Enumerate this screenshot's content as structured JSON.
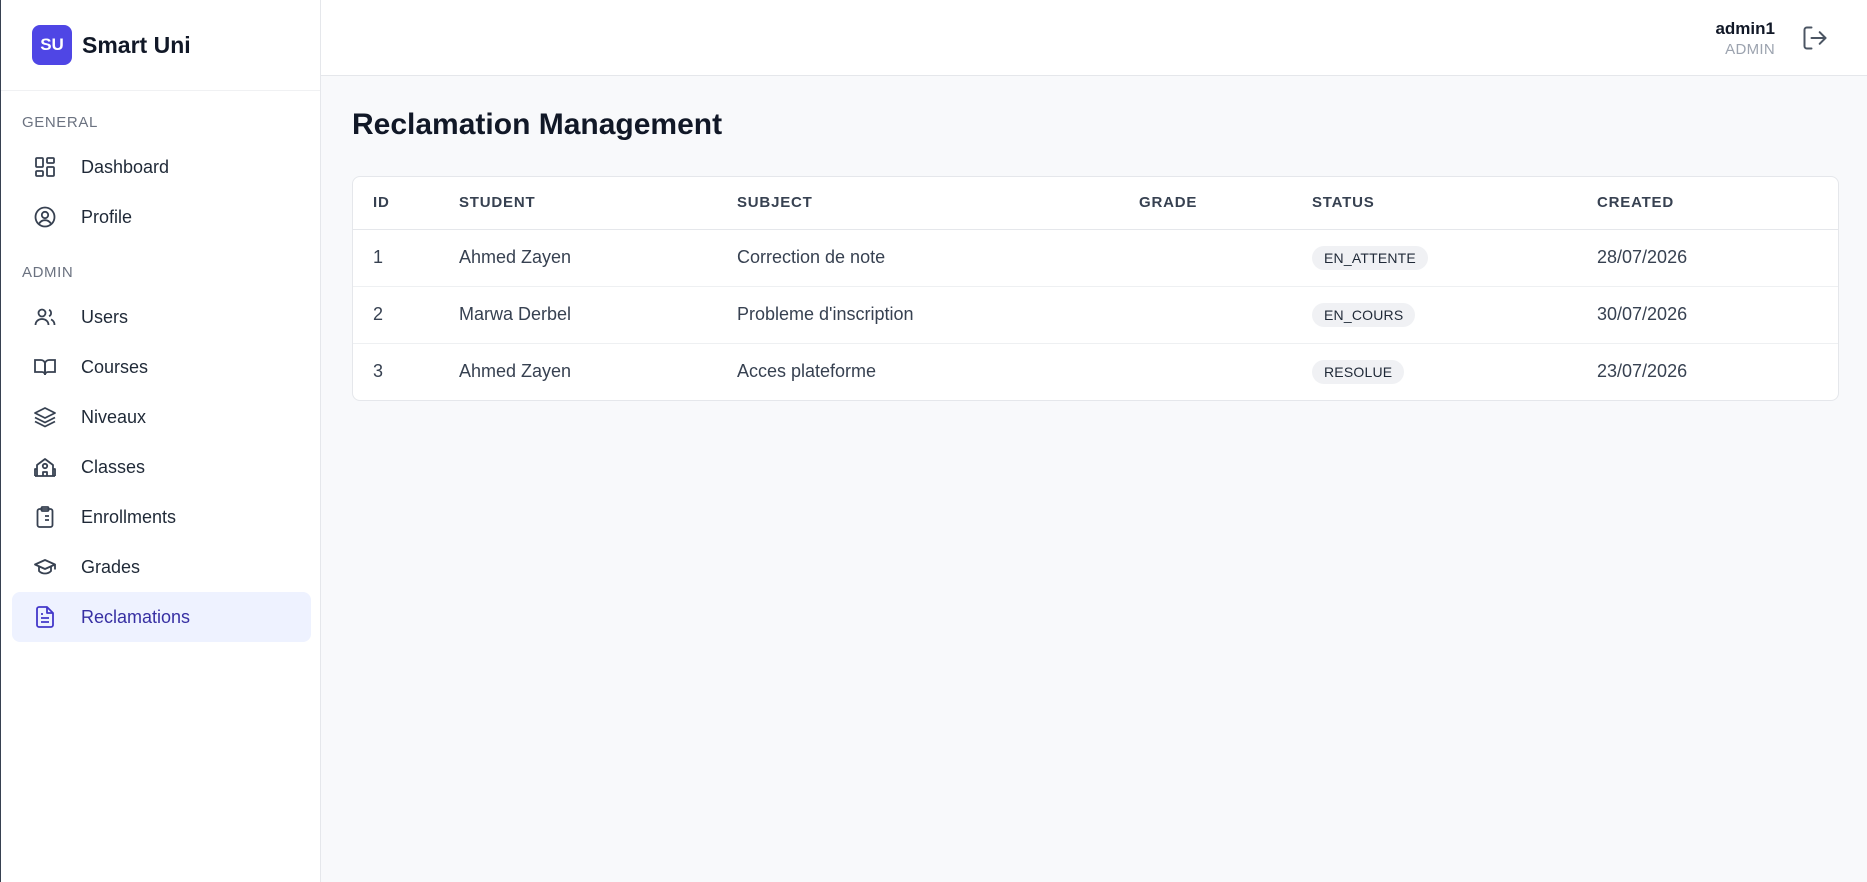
{
  "brand": {
    "logo_text": "SU",
    "name": "Smart Uni"
  },
  "sidebar": {
    "sections": [
      {
        "title": "GENERAL"
      },
      {
        "title": "ADMIN"
      }
    ],
    "items": [
      {
        "label": "Dashboard",
        "icon": "dashboard-icon"
      },
      {
        "label": "Profile",
        "icon": "user-circle-icon"
      },
      {
        "label": "Users",
        "icon": "users-icon"
      },
      {
        "label": "Courses",
        "icon": "book-icon"
      },
      {
        "label": "Niveaux",
        "icon": "layers-icon"
      },
      {
        "label": "Classes",
        "icon": "school-icon"
      },
      {
        "label": "Enrollments",
        "icon": "clipboard-list-icon"
      },
      {
        "label": "Grades",
        "icon": "graduation-cap-icon"
      },
      {
        "label": "Reclamations",
        "icon": "file-text-icon",
        "active": true
      }
    ]
  },
  "header": {
    "user_name": "admin1",
    "user_role": "ADMIN",
    "logout_icon": "logout-icon"
  },
  "main": {
    "title": "Reclamation Management",
    "table": {
      "columns": [
        "ID",
        "STUDENT",
        "SUBJECT",
        "GRADE",
        "STATUS",
        "CREATED"
      ],
      "rows": [
        {
          "id": "1",
          "student": "Ahmed Zayen",
          "subject": "Correction de note",
          "grade": "",
          "status": "EN_ATTENTE",
          "created": "28/07/2026"
        },
        {
          "id": "2",
          "student": "Marwa Derbel",
          "subject": "Probleme d'inscription",
          "grade": "",
          "status": "EN_COURS",
          "created": "30/07/2026"
        },
        {
          "id": "3",
          "student": "Ahmed Zayen",
          "subject": "Acces plateforme",
          "grade": "",
          "status": "RESOLUE",
          "created": "23/07/2026"
        }
      ]
    }
  },
  "colors": {
    "accent": "#4f46e5",
    "active_bg": "#eef2ff",
    "active_text": "#3730a3"
  }
}
